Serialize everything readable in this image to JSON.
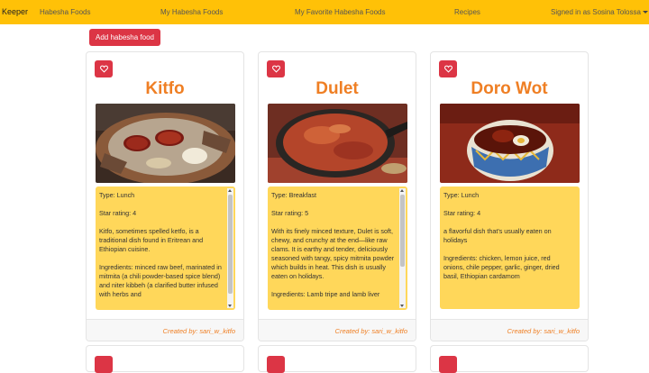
{
  "navbar": {
    "brand": "Keeper",
    "links": [
      "Habesha Foods",
      "My Habesha Foods",
      "My Favorite Habesha Foods",
      "Recipes"
    ],
    "user": "Signed in as Sosina Tolossa"
  },
  "toolbar": {
    "add_label": "Add habesha food"
  },
  "cards": [
    {
      "title": "Kitfo",
      "type": "Type: Lunch",
      "rating": "Star rating: 4",
      "description": "Kitfo, sometimes spelled ketfo, is a traditional dish found in Eritrean and Ethiopian cuisine.",
      "ingredients": "Ingredients: minced raw beef, marinated in mitmita (a chili powder-based spice blend) and niter kibbeh (a clarified butter infused with herbs and",
      "creator": "Created by: sari_w_kitfo"
    },
    {
      "title": "Dulet",
      "type": "Type: Breakfast",
      "rating": "Star rating: 5",
      "description": "With its finely minced texture, Dulet is soft, chewy, and crunchy at the end—like raw clams. It is earthy and tender, deliciously seasoned with tangy, spicy mitmita powder which builds in heat. This dish is usually eaten on holidays.",
      "ingredients": "Ingredients: Lamb tripe and lamb liver",
      "creator": "Created by: sari_w_kitfo"
    },
    {
      "title": "Doro Wot",
      "type": "Type: Lunch",
      "rating": "Star rating: 4",
      "description": "a flavorful dish that's usually eaten on holidays",
      "ingredients": "Ingredients: chicken, lemon juice, red onions, chile pepper, garlic, ginger, dried basil, Ethiopian cardamom",
      "creator": "Created by: sari_w_kitfo"
    }
  ],
  "colors": {
    "navbar": "#ffc107",
    "accent": "#dc3545",
    "title": "#ef7f24",
    "info_bg": "#ffd75a"
  }
}
